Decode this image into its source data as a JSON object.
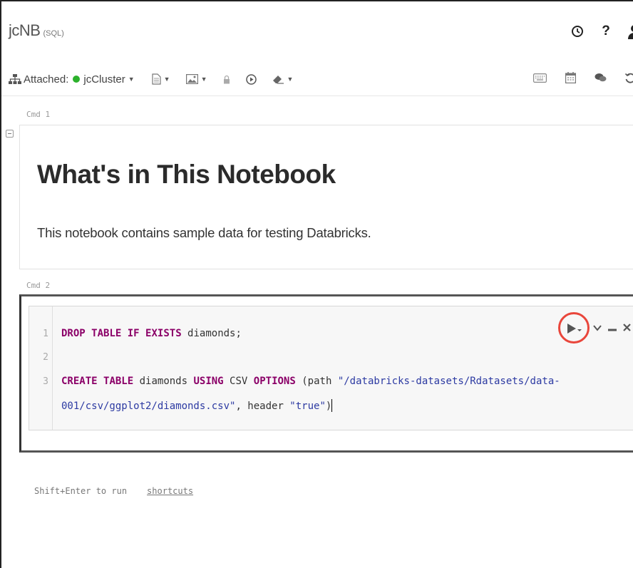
{
  "header": {
    "notebook_name": "jcNB",
    "language": "(SQL)",
    "icons": [
      "clock-icon",
      "help-icon",
      "user-icon"
    ]
  },
  "toolbar": {
    "attached_label": "Attached:",
    "cluster_name": "jcCluster",
    "cluster_status_color": "#2cb12c",
    "file_menu_icon": "document-icon",
    "view_menu_icon": "image-icon",
    "permissions_icon": "lock-icon",
    "run_all_icon": "play-circle-icon",
    "clear_icon": "eraser-icon",
    "right_icons": [
      "keyboard-icon",
      "calendar-icon",
      "comments-icon",
      "history-icon"
    ]
  },
  "cells": [
    {
      "label": "Cmd 1",
      "type": "markdown",
      "heading": "What's in This Notebook",
      "paragraph": "This notebook contains sample data for testing Databricks."
    },
    {
      "label": "Cmd 2",
      "type": "code",
      "lines": [
        {
          "num": "1",
          "text": "DROP TABLE IF EXISTS diamonds;"
        },
        {
          "num": "2",
          "text": ""
        },
        {
          "num": "3",
          "text": "CREATE TABLE diamonds USING CSV OPTIONS (path \"/databricks-datasets/Rdatasets/data-"
        },
        {
          "num": "",
          "text": "001/csv/ggplot2/diamonds.csv\", header \"true\")"
        }
      ],
      "highlight_color": "#e9463b"
    }
  ],
  "footer": {
    "hint": "Shift+Enter to run",
    "shortcuts_link": "shortcuts"
  },
  "colors": {
    "keyword": "#8b0068",
    "string": "#2c3aa2"
  }
}
